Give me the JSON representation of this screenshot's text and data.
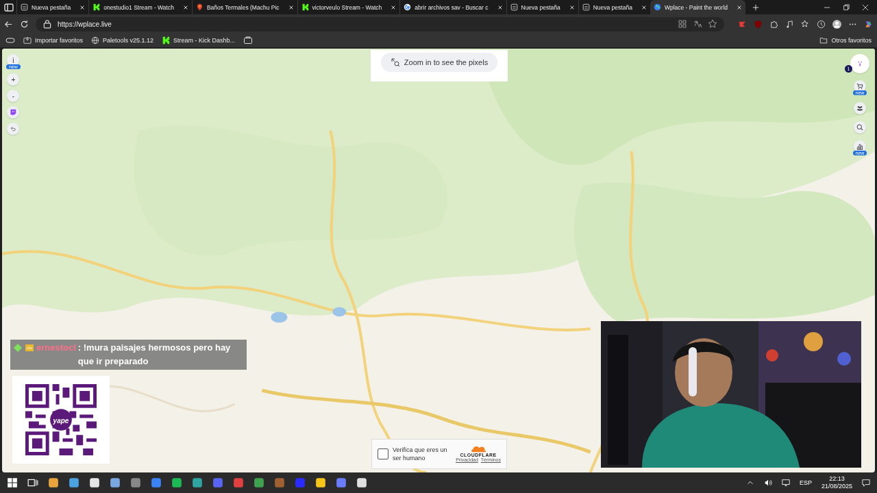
{
  "tabs": [
    {
      "title": "Nueva pestaña",
      "kind": "page",
      "selected": false
    },
    {
      "title": "onestudio1 Stream - Watch",
      "kind": "kick",
      "selected": false
    },
    {
      "title": "Baños Termales (Machu Pic",
      "kind": "maps",
      "selected": false
    },
    {
      "title": "victorveulo Stream - Watch",
      "kind": "kick",
      "selected": false
    },
    {
      "title": "abrir archivos sav - Buscar c",
      "kind": "google",
      "selected": false
    },
    {
      "title": "Nueva pestaña",
      "kind": "page",
      "selected": false
    },
    {
      "title": "Nueva pestaña",
      "kind": "page",
      "selected": false
    },
    {
      "title": "Wplace - Paint the world",
      "kind": "globe",
      "selected": true
    }
  ],
  "address": "https://wplace.live",
  "bookmarks": [
    {
      "label": "Importar favoritos",
      "kind": "import"
    },
    {
      "label": "Paletools v25.1.12",
      "kind": "globe"
    },
    {
      "label": "Stream - Kick Dashb...",
      "kind": "kick"
    }
  ],
  "other_bookmarks": "Otros favoritos",
  "zoom_hint": "Zoom in to see the pixels",
  "left_controls": [
    {
      "kind": "text",
      "label": "i",
      "badge": "new"
    },
    {
      "kind": "text",
      "label": "+"
    },
    {
      "kind": "text",
      "label": "-"
    },
    {
      "kind": "twitch"
    },
    {
      "kind": "undo"
    }
  ],
  "right_controls": [
    {
      "kind": "avatar",
      "count": "1"
    },
    {
      "kind": "cart",
      "badge": "new"
    },
    {
      "kind": "people"
    },
    {
      "kind": "search"
    },
    {
      "kind": "chart",
      "badge": "new"
    }
  ],
  "chat": {
    "user": "ernestocl",
    "message": ": !mura paisajes hermosos pero hay que ir preparado"
  },
  "qr": {
    "logo": "yape"
  },
  "captcha": {
    "label": "Verifica que eres un ser humano",
    "checked": false,
    "brand": "CLOUDFLARE",
    "links": [
      "Privacidad",
      "Términos"
    ]
  },
  "tray": {
    "language": "ESP",
    "time": "22:13",
    "date": "21/08/2025"
  }
}
